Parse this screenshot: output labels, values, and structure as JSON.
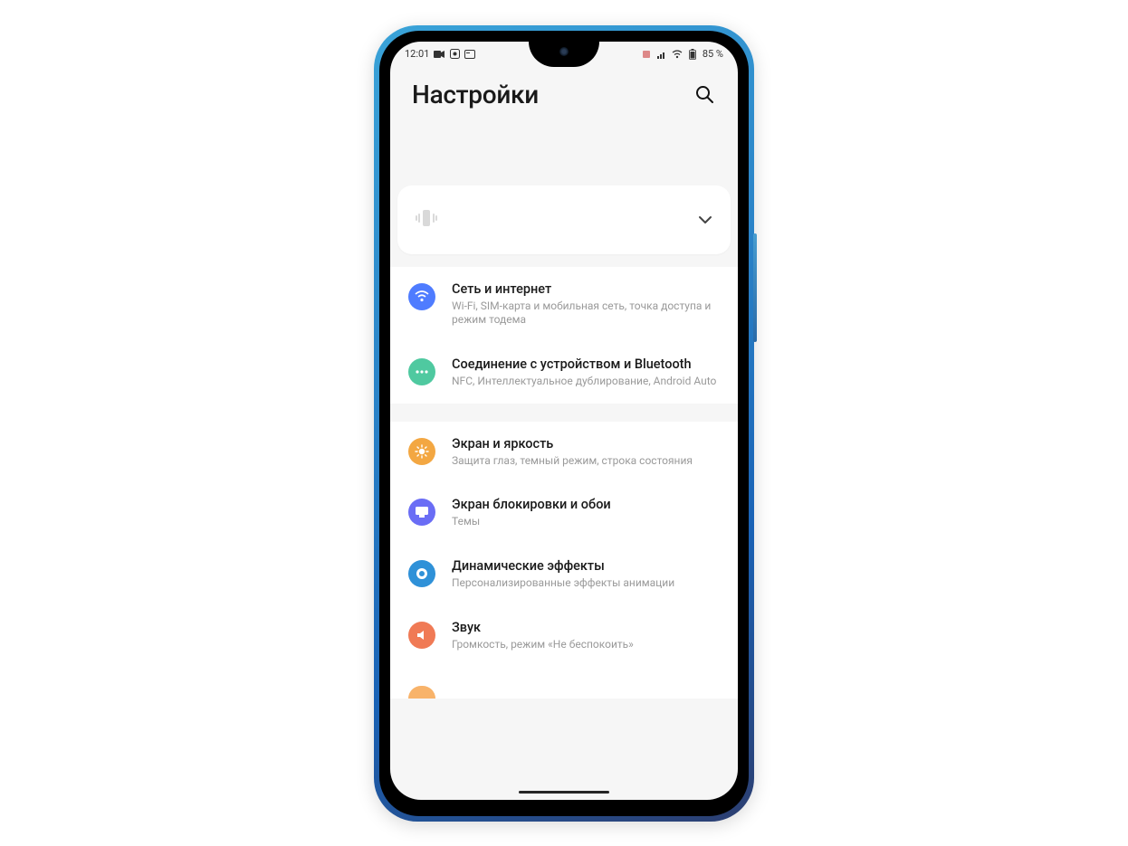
{
  "status": {
    "time": "12:01",
    "battery_text": "85 %"
  },
  "header": {
    "title": "Настройки"
  },
  "groups": [
    {
      "items": [
        {
          "icon_name": "wifi-icon",
          "icon_class": "ic-blue",
          "title": "Сеть и интернет",
          "subtitle": "Wi-Fi, SIM-карта и мобильная сеть, точка доступа и режим тодема"
        },
        {
          "icon_name": "more-icon",
          "icon_class": "ic-green",
          "title": "Соединение с устройством и Bluetooth",
          "subtitle": "NFC, Интеллектуальное дублирование, Android Auto"
        }
      ]
    },
    {
      "items": [
        {
          "icon_name": "brightness-icon",
          "icon_class": "ic-orange",
          "title": "Экран и яркость",
          "subtitle": "Защита глаз, темный режим, строка состояния"
        },
        {
          "icon_name": "wallpaper-icon",
          "icon_class": "ic-violet",
          "title": "Экран блокировки и обои",
          "subtitle": "Темы"
        },
        {
          "icon_name": "effects-icon",
          "icon_class": "ic-teal",
          "title": "Динамические эффекты",
          "subtitle": "Персонализированные эффекты анимации"
        },
        {
          "icon_name": "sound-icon",
          "icon_class": "ic-coral",
          "title": "Звук",
          "subtitle": "Громкость, режим «Не беспокоить»"
        }
      ]
    }
  ]
}
